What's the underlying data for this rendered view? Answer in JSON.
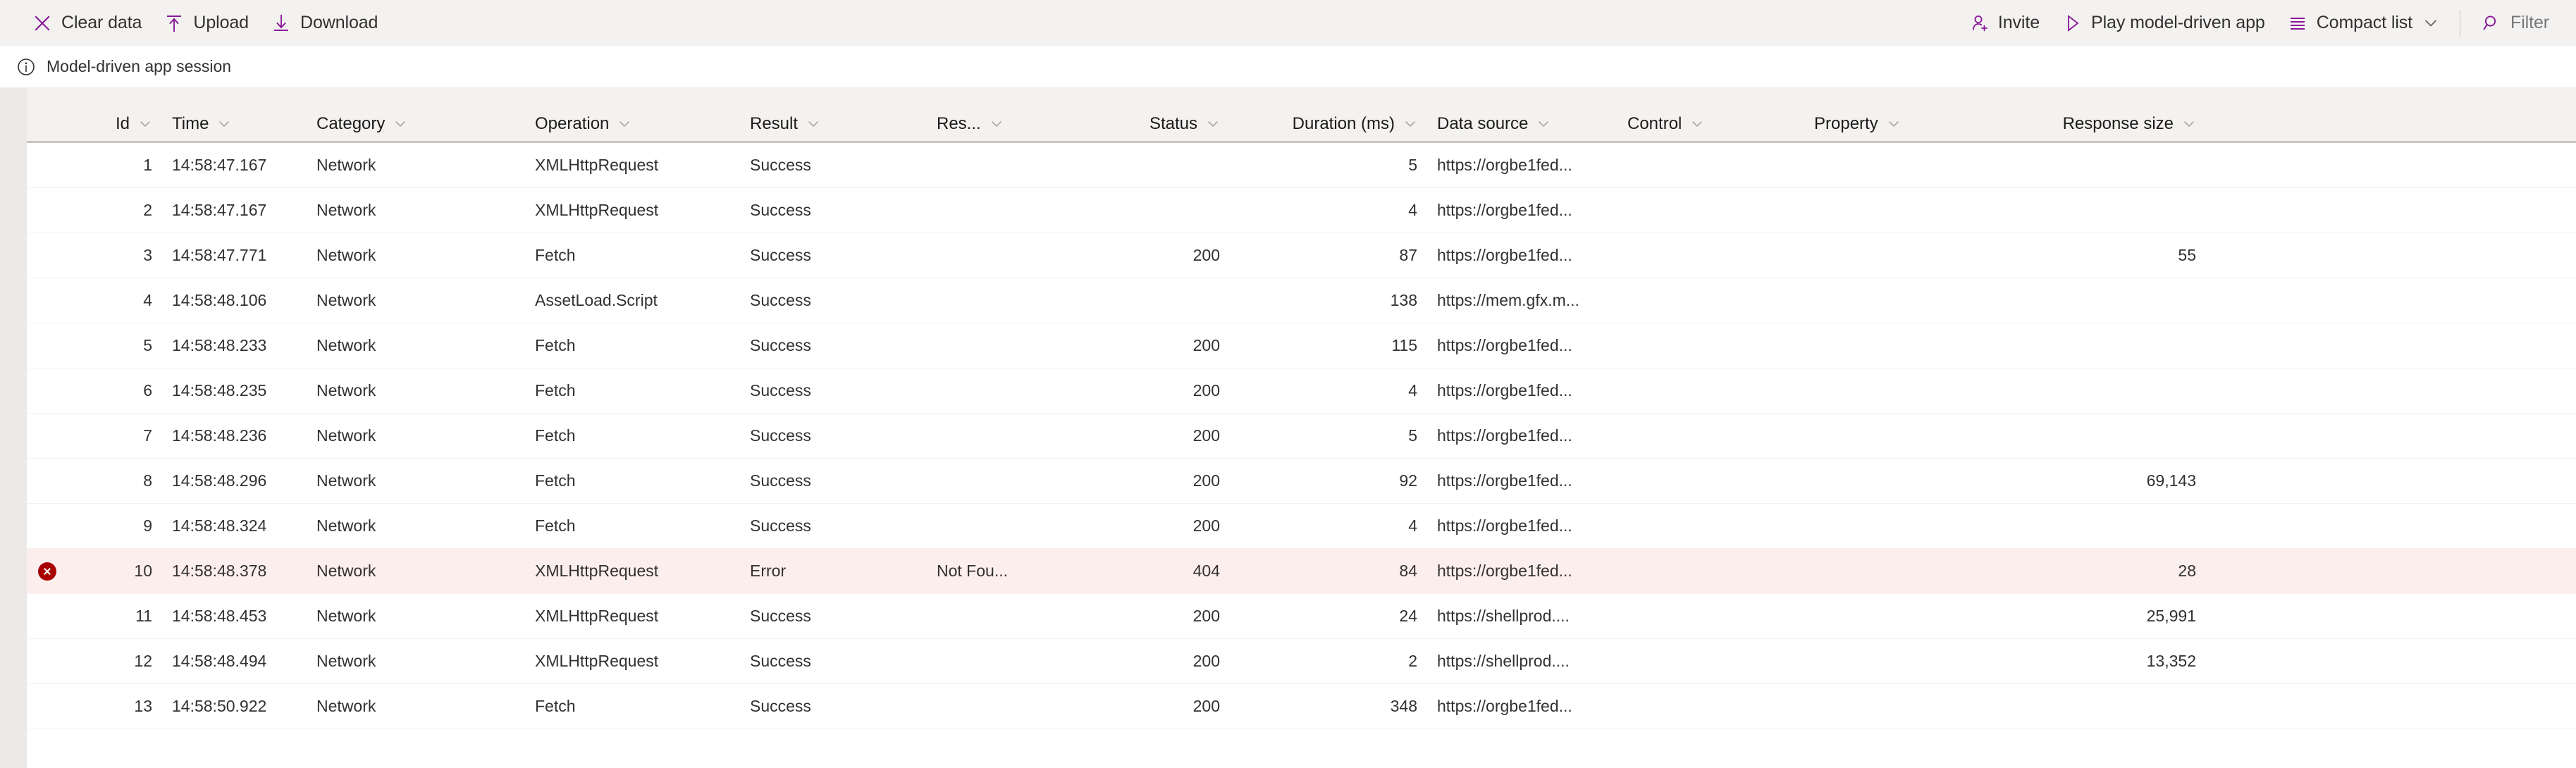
{
  "toolbar": {
    "left_actions": [
      {
        "label": "Clear data",
        "icon": "close-x-icon"
      },
      {
        "label": "Upload",
        "icon": "upload-arrow-icon"
      },
      {
        "label": "Download",
        "icon": "download-arrow-icon"
      }
    ],
    "right_actions": [
      {
        "label": "Invite",
        "icon": "add-person-icon"
      },
      {
        "label": "Play model-driven app",
        "icon": "play-triangle-icon"
      },
      {
        "label": "Compact list",
        "icon": "list-lines-icon",
        "has_chevron": true
      }
    ],
    "filter": {
      "label": "Filter",
      "icon": "search-icon",
      "muted": true
    }
  },
  "session": {
    "icon": "info-circle-icon",
    "text": "Model-driven app session"
  },
  "table": {
    "columns": [
      {
        "key": "id",
        "label": "Id",
        "align": "right",
        "class": "c-id"
      },
      {
        "key": "time",
        "label": "Time",
        "align": "left",
        "class": "c-time"
      },
      {
        "key": "category",
        "label": "Category",
        "align": "left",
        "class": "c-category"
      },
      {
        "key": "operation",
        "label": "Operation",
        "align": "left",
        "class": "c-operation"
      },
      {
        "key": "result",
        "label": "Result",
        "align": "left",
        "class": "c-result"
      },
      {
        "key": "res",
        "label": "Res...",
        "align": "left",
        "class": "c-res"
      },
      {
        "key": "status",
        "label": "Status",
        "align": "right",
        "class": "c-status"
      },
      {
        "key": "duration",
        "label": "Duration (ms)",
        "align": "right",
        "class": "c-duration"
      },
      {
        "key": "source",
        "label": "Data source",
        "align": "left",
        "class": "c-source"
      },
      {
        "key": "control",
        "label": "Control",
        "align": "left",
        "class": "c-control"
      },
      {
        "key": "property",
        "label": "Property",
        "align": "left",
        "class": "c-property"
      },
      {
        "key": "response",
        "label": "Response size",
        "align": "right",
        "class": "c-response"
      }
    ],
    "rows": [
      {
        "error": false,
        "id": "1",
        "time": "14:58:47.167",
        "category": "Network",
        "operation": "XMLHttpRequest",
        "result": "Success",
        "res": "",
        "status": "",
        "duration": "5",
        "source": "https://orgbe1fed...",
        "control": "",
        "property": "",
        "response": ""
      },
      {
        "error": false,
        "id": "2",
        "time": "14:58:47.167",
        "category": "Network",
        "operation": "XMLHttpRequest",
        "result": "Success",
        "res": "",
        "status": "",
        "duration": "4",
        "source": "https://orgbe1fed...",
        "control": "",
        "property": "",
        "response": ""
      },
      {
        "error": false,
        "id": "3",
        "time": "14:58:47.771",
        "category": "Network",
        "operation": "Fetch",
        "result": "Success",
        "res": "",
        "status": "200",
        "duration": "87",
        "source": "https://orgbe1fed...",
        "control": "",
        "property": "",
        "response": "55"
      },
      {
        "error": false,
        "id": "4",
        "time": "14:58:48.106",
        "category": "Network",
        "operation": "AssetLoad.Script",
        "result": "Success",
        "res": "",
        "status": "",
        "duration": "138",
        "source": "https://mem.gfx.m...",
        "control": "",
        "property": "",
        "response": ""
      },
      {
        "error": false,
        "id": "5",
        "time": "14:58:48.233",
        "category": "Network",
        "operation": "Fetch",
        "result": "Success",
        "res": "",
        "status": "200",
        "duration": "115",
        "source": "https://orgbe1fed...",
        "control": "",
        "property": "",
        "response": ""
      },
      {
        "error": false,
        "id": "6",
        "time": "14:58:48.235",
        "category": "Network",
        "operation": "Fetch",
        "result": "Success",
        "res": "",
        "status": "200",
        "duration": "4",
        "source": "https://orgbe1fed...",
        "control": "",
        "property": "",
        "response": ""
      },
      {
        "error": false,
        "id": "7",
        "time": "14:58:48.236",
        "category": "Network",
        "operation": "Fetch",
        "result": "Success",
        "res": "",
        "status": "200",
        "duration": "5",
        "source": "https://orgbe1fed...",
        "control": "",
        "property": "",
        "response": ""
      },
      {
        "error": false,
        "id": "8",
        "time": "14:58:48.296",
        "category": "Network",
        "operation": "Fetch",
        "result": "Success",
        "res": "",
        "status": "200",
        "duration": "92",
        "source": "https://orgbe1fed...",
        "control": "",
        "property": "",
        "response": "69,143"
      },
      {
        "error": false,
        "id": "9",
        "time": "14:58:48.324",
        "category": "Network",
        "operation": "Fetch",
        "result": "Success",
        "res": "",
        "status": "200",
        "duration": "4",
        "source": "https://orgbe1fed...",
        "control": "",
        "property": "",
        "response": ""
      },
      {
        "error": true,
        "id": "10",
        "time": "14:58:48.378",
        "category": "Network",
        "operation": "XMLHttpRequest",
        "result": "Error",
        "res": "Not Fou...",
        "status": "404",
        "duration": "84",
        "source": "https://orgbe1fed...",
        "control": "",
        "property": "",
        "response": "28"
      },
      {
        "error": false,
        "id": "11",
        "time": "14:58:48.453",
        "category": "Network",
        "operation": "XMLHttpRequest",
        "result": "Success",
        "res": "",
        "status": "200",
        "duration": "24",
        "source": "https://shellprod....",
        "control": "",
        "property": "",
        "response": "25,991"
      },
      {
        "error": false,
        "id": "12",
        "time": "14:58:48.494",
        "category": "Network",
        "operation": "XMLHttpRequest",
        "result": "Success",
        "res": "",
        "status": "200",
        "duration": "2",
        "source": "https://shellprod....",
        "control": "",
        "property": "",
        "response": "13,352"
      },
      {
        "error": false,
        "id": "13",
        "time": "14:58:50.922",
        "category": "Network",
        "operation": "Fetch",
        "result": "Success",
        "res": "",
        "status": "200",
        "duration": "348",
        "source": "https://orgbe1fed...",
        "control": "",
        "property": "",
        "response": ""
      }
    ]
  },
  "colors": {
    "accent": "#881798",
    "toolbar_bg": "#f3f2f1",
    "error_row_bg": "#fdeeee",
    "error_badge": "#a80000",
    "text": "#323130"
  }
}
